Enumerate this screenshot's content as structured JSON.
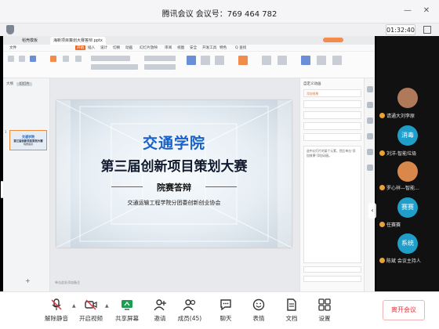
{
  "window": {
    "title": "腾讯会议  会议号：769 464 782",
    "timer": "01:32:40"
  },
  "wps": {
    "tabs": [
      "稻壳模板",
      "海新项目策划大赛答辩.pptx"
    ],
    "menu": [
      "文件",
      "开始",
      "插入",
      "设计",
      "切换",
      "动画",
      "幻灯片放映",
      "审阅",
      "视图",
      "安全",
      "开发工具",
      "特色",
      "Q 查找"
    ],
    "menu_active": "开始",
    "left_tabs": {
      "outline": "大纲",
      "slides": "幻灯片"
    },
    "thumb": {
      "title": "交通学院",
      "subtitle": "第三届创新项目策划大赛",
      "line3": "院赛答辩",
      "num": "1"
    },
    "notes_hint": "单击此处添加备注",
    "right_panel": {
      "title": "自定义动画",
      "button": "添加效果",
      "hint": "选中幻灯片的某个元素，然后单击\"添加效果\"添加动画。"
    }
  },
  "slide": {
    "title1": "交通学院",
    "title2": "第三届创新项目策划大赛",
    "subtitle": "院赛答辩",
    "org": "交通运输工程学院分团委创新创业协会"
  },
  "participants": [
    {
      "name": "请通大刘李原",
      "avatar_text": "",
      "avatar_color": "#b07a5a"
    },
    {
      "name": "刘洋-智能垃圾",
      "avatar_text": "消毒",
      "avatar_color": "#1f9ec9"
    },
    {
      "name": "罗心祥—智能...",
      "avatar_text": "",
      "avatar_color": "#d9874a"
    },
    {
      "name": "任赛赛",
      "avatar_text": "赛赛",
      "avatar_color": "#1f9ec9"
    },
    {
      "name": "陈斌 会议主持人",
      "avatar_text": "系统",
      "avatar_color": "#1f9ec9"
    }
  ],
  "toolbar": {
    "mute": "解除静音",
    "video": "开启视频",
    "share": "共享屏幕",
    "invite": "邀请",
    "members": "成员(45)",
    "chat": "聊天",
    "reactions": "表情",
    "docs": "文档",
    "settings": "设置",
    "leave": "离开会议"
  },
  "colors": {
    "accent_orange": "#f06a26",
    "title_blue": "#1761c9",
    "leave_red": "#e5333d"
  }
}
